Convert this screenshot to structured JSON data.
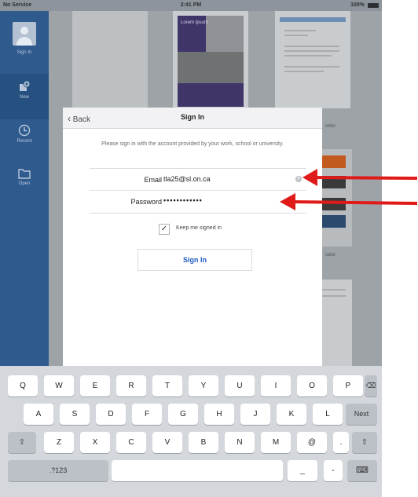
{
  "status_bar": {
    "carrier": "No Service",
    "time": "2:41 PM",
    "battery": "100%"
  },
  "sidebar": {
    "items": [
      {
        "label": "Sign In",
        "icon": "avatar-icon"
      },
      {
        "label": "New",
        "icon": "new-document-icon"
      },
      {
        "label": "Recent",
        "icon": "clock-icon"
      },
      {
        "label": "Open",
        "icon": "folder-icon"
      }
    ]
  },
  "background": {
    "thumb_captions": [
      "Lorem Ipsum",
      "letter",
      "table"
    ]
  },
  "modal": {
    "back_label": "Back",
    "title": "Sign In",
    "instructions": "Please sign in with the account provided by your work, school or university.",
    "email_label": "Email",
    "email_value": "tla25@sl.on.ca",
    "password_label": "Password",
    "password_value": "••••••••••••",
    "keep_signed_in_label": "Keep me signed in",
    "keep_signed_in_checked": true,
    "sign_in_button": "Sign In"
  },
  "keyboard": {
    "row1": [
      "Q",
      "W",
      "E",
      "R",
      "T",
      "Y",
      "U",
      "I",
      "O",
      "P"
    ],
    "row2": [
      "A",
      "S",
      "D",
      "F",
      "G",
      "H",
      "J",
      "K",
      "L"
    ],
    "row3": [
      "Z",
      "X",
      "C",
      "V",
      "B",
      "N",
      "M",
      "@",
      "."
    ],
    "next_label": "Next",
    "numbers_label": ".?123",
    "underscore_label": "_",
    "dash_label": "-"
  },
  "colors": {
    "sidebar": "#2f5a8e",
    "link_blue": "#1d5bbf",
    "arrow_red": "#e01919"
  }
}
